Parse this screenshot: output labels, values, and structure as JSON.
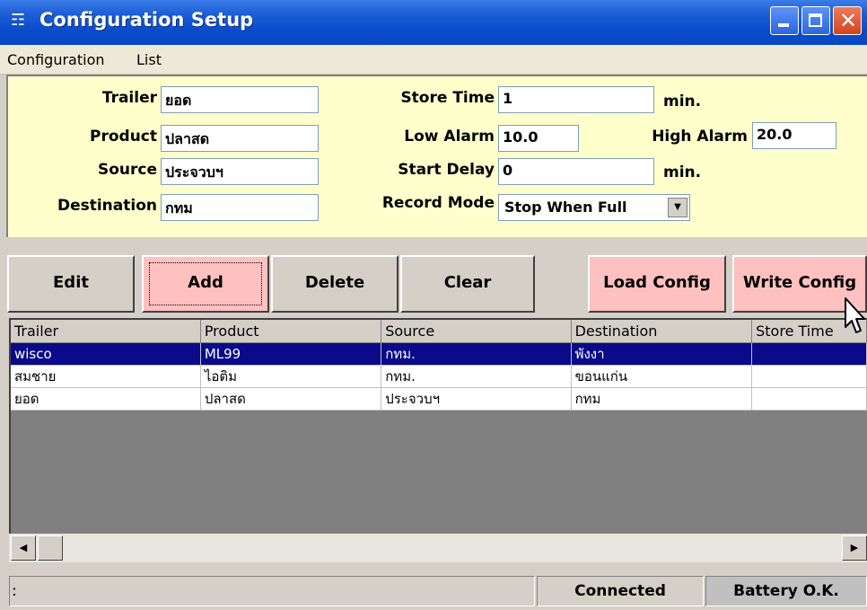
{
  "window": {
    "title": "Configuration Setup"
  },
  "menu": [
    "Configuration",
    "List"
  ],
  "form": {
    "trailer_label": "Trailer",
    "trailer_value": "ยอด",
    "product_label": "Product",
    "product_value": "ปลาสด",
    "source_label": "Source",
    "source_value": "ประจวบฯ",
    "destination_label": "Destination",
    "destination_value": "กทม",
    "store_time_label": "Store Time",
    "store_time_value": "1",
    "store_time_unit": "min.",
    "low_alarm_label": "Low Alarm",
    "low_alarm_value": "10.0",
    "high_alarm_label": "High Alarm",
    "high_alarm_value": "20.0",
    "start_delay_label": "Start Delay",
    "start_delay_value": "0",
    "start_delay_unit": "min.",
    "record_mode_label": "Record Mode",
    "record_mode_value": "Stop When Full"
  },
  "buttons": {
    "edit": "Edit",
    "add": "Add",
    "delete": "Delete",
    "clear": "Clear",
    "load_config": "Load Config",
    "write_config": "Write Config"
  },
  "grid": {
    "columns": [
      "Trailer",
      "Product",
      "Source",
      "Destination",
      "Store Time"
    ],
    "rows": [
      [
        "wisco",
        "ML99",
        "กทม.",
        "พังงา",
        ""
      ],
      [
        "สมชาย",
        "ไอติม",
        "กทม.",
        "ขอนแก่น",
        ""
      ],
      [
        "ยอด",
        "ปลาสด",
        "ประจวบฯ",
        "กทม",
        ""
      ]
    ],
    "selected_row": 0
  },
  "status": {
    "pane1": ":",
    "connection": "Connected",
    "battery": "Battery O.K."
  },
  "colors": {
    "titlebar": "#0a4bcc",
    "form_bg": "#ffffcc",
    "pink_button": "#ffc0c0",
    "selection": "#0a0a8a"
  }
}
